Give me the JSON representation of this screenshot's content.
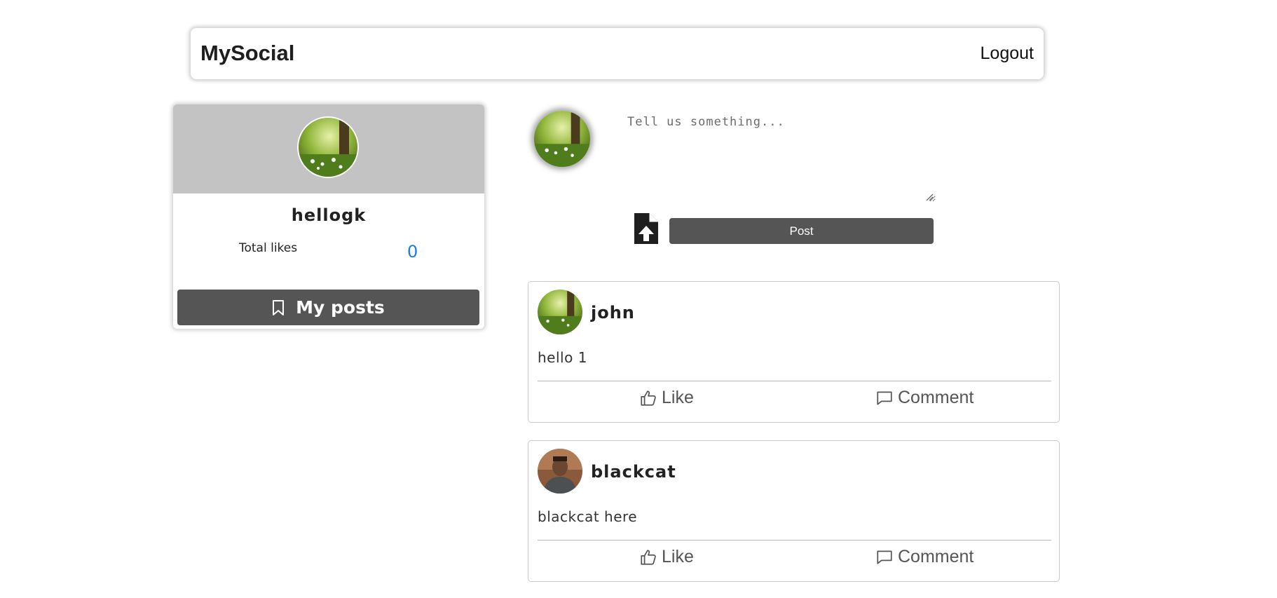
{
  "navbar": {
    "brand": "MySocial",
    "logout_label": "Logout"
  },
  "profile": {
    "username": "hellogk",
    "likes_label": "Total likes",
    "likes_count": "0",
    "my_posts_label": "My posts",
    "banner_color": "#c3c3c3"
  },
  "composer": {
    "placeholder": "Tell us something...",
    "post_label": "Post"
  },
  "posts": [
    {
      "author": "john",
      "body": "hello 1",
      "like_label": "Like",
      "comment_label": "Comment"
    },
    {
      "author": "blackcat",
      "body": "blackcat here",
      "like_label": "Like",
      "comment_label": "Comment"
    }
  ],
  "colors": {
    "accent_dark": "#555555",
    "likes_blue": "#1a7cf0"
  },
  "icons": {
    "bookmark": "bookmark-icon",
    "upload": "file-upload-icon",
    "like": "thumbs-up-icon",
    "comment": "comment-icon"
  }
}
